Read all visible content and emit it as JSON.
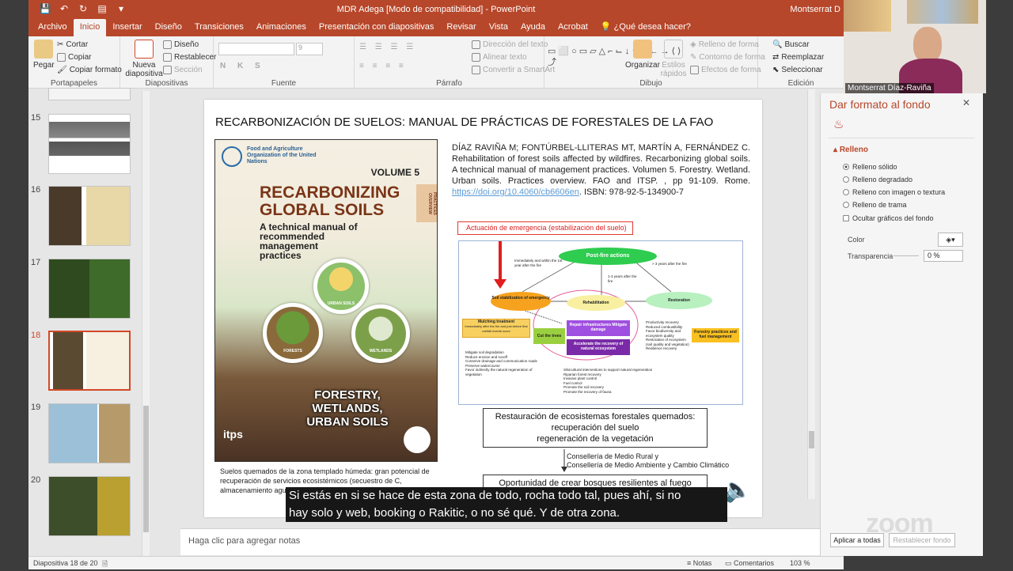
{
  "window": {
    "title": "MDR Adega [Modo de compatibilidad] - PowerPoint",
    "user": "Montserrat D"
  },
  "menu": [
    "Archivo",
    "Inicio",
    "Insertar",
    "Diseño",
    "Transiciones",
    "Animaciones",
    "Presentación con diapositivas",
    "Revisar",
    "Vista",
    "Ayuda",
    "Acrobat",
    "¿Qué desea hacer?"
  ],
  "ribbon": {
    "clipboard": {
      "paste": "Pegar",
      "cut": "Cortar",
      "copy": "Copiar",
      "format_painter": "Copiar formato",
      "label": "Portapapeles"
    },
    "slides": {
      "new_slide": "Nueva diapositiva",
      "layout": "Diseño",
      "reset": "Restablecer",
      "section": "Sección",
      "label": "Diapositivas"
    },
    "font": {
      "size": "9",
      "label": "Fuente"
    },
    "paragraph": {
      "text_direction": "Dirección del texto",
      "align_text": "Alinear texto",
      "smartart": "Convertir a SmartArt",
      "label": "Párrafo"
    },
    "drawing": {
      "arrange": "Organizar",
      "quick_styles": "Estilos rápidos",
      "shape_fill": "Relleno de forma",
      "shape_outline": "Contorno de forma",
      "shape_effects": "Efectos de forma",
      "label": "Dibujo"
    },
    "editing": {
      "find": "Buscar",
      "replace": "Reemplazar",
      "select": "Seleccionar",
      "label": "Edición"
    }
  },
  "thumbnails": [
    {
      "num": "15",
      "selected": false
    },
    {
      "num": "16",
      "selected": false
    },
    {
      "num": "17",
      "selected": false
    },
    {
      "num": "18",
      "selected": true
    },
    {
      "num": "19",
      "selected": false
    },
    {
      "num": "20",
      "selected": false
    }
  ],
  "slide": {
    "title": "RECARBONIZACIÓN DE SUELOS: MANUAL DE PRÁCTICAS DE FORESTALES DE LA FAO",
    "cover": {
      "org": "Food and Agriculture Organization of the United Nations",
      "volume": "VOLUME 5",
      "title1": "RECARBONIZING",
      "title2": "GLOBAL SOILS",
      "subtitle": "A technical manual of recommended management practices",
      "tab": "PRACTICES OVERVIEW",
      "circle_urban": "URBAN SOILS",
      "circle_forests": "FORESTS",
      "circle_wetlands": "WETLANDS",
      "bottom1": "FORESTRY,",
      "bottom2": "WETLANDS,",
      "bottom3": "URBAN SOILS",
      "itps": "itps"
    },
    "reference": "DÍAZ RAVIÑA M; FONTÚRBEL-LLITERAS MT, MARTÍN A, FERNÁNDEZ C. Rehabilitation of forest soils affected by wildfires. Recarbonizing global soils. A technical manual of management practices. Volumen 5. Forestry. Wetland. Urban soils. Practices overview. FAO and ITSP. , pp 91-109. Rome.",
    "doi": "https://doi.org/10.4060/cb6606en",
    "isbn": ". ISBN: 978-92-5-134900-7",
    "caption": "Suelos quemados de la zona templado húmeda: gran potencial de recuperación de servicios ecosistémicos (secuestro de C, almacenamiento agua, mantenimiento biodiversidad)",
    "emergency_label": "Actuación de emergencia (estabilización del suelo)",
    "diagram": {
      "postfire": "Post-fire actions",
      "within": "Immediately and within the 1st year after the fire",
      "years3": "> 3 years after the fire",
      "years13": "1-3 years after the fire",
      "stabilization": "Soil stabilization of emergency",
      "rehabilitation": "Rehabilitation",
      "restoration": "Restoration",
      "mulching": "Mulching treatment",
      "mulching_note": "Immediately after the fire and just before first rainfall events occur",
      "cut_trees": "Cut the trees",
      "repair": "Repair infrastructures Mitigate damage",
      "accelerate": "Accelerate the recovery of natural ecosystem",
      "forestry": "Forestry practices and fuel management",
      "stab_list": [
        "Mitigate soil degradation",
        "Reduce erosion and runoff",
        "Conserve drainage and communication roads",
        "Preserve watercourse",
        "Favor indirectly the natural regeneration of",
        "vegetation"
      ],
      "rest_list": [
        "Productivity recovery",
        "Reduced combustibility",
        "Favor biodiversity and",
        "ecosystem quality",
        "Restoration of ecosystem",
        "(soil quality and vegetation)",
        "Resilience recovery"
      ],
      "rehab_list": [
        "Silvicultural interventions to support natural regeneration",
        "Riparian forest recovery",
        "Invasive plant control",
        "Fuel control",
        "Promote the soil recovery",
        "Promote the recovery of fauna"
      ]
    },
    "box1_l1": "Restauración de ecosistemas forestales quemados:",
    "box1_l2": "recuperación del suelo",
    "box1_l3": "regeneración de la vegetación",
    "cons1": "Consellería de Medio Rural y",
    "cons2": "Consellería de Medio Ambiente y Cambio Climático",
    "box2": "Oportunidad de crear bosques resilientes al fuego"
  },
  "subtitle_line1": "Si estás en si se hace de esta zona de todo, rocha todo tal, pues ahí, si no",
  "subtitle_line2": "hay solo y web, booking o Rakitic, o no sé qué. Y de otra zona.",
  "notes_placeholder": "Haga clic para agregar notas",
  "status": {
    "slide": "Diapositiva 18 de 20",
    "notes": "Notas",
    "comments": "Comentarios",
    "zoom": "103 %"
  },
  "format_pane": {
    "title": "Dar formato al fondo",
    "section": "Relleno",
    "options": [
      "Relleno sólido",
      "Relleno degradado",
      "Relleno con imagen o textura",
      "Relleno de trama"
    ],
    "hide": "Ocultar gráficos del fondo",
    "color": "Color",
    "transparency": "Transparencia",
    "transparency_value": "0 %",
    "apply_all": "Aplicar a todas",
    "reset": "Restablecer fondo"
  },
  "video": {
    "name": "Montserrat Díaz-Raviña",
    "watermark": "zoom"
  }
}
